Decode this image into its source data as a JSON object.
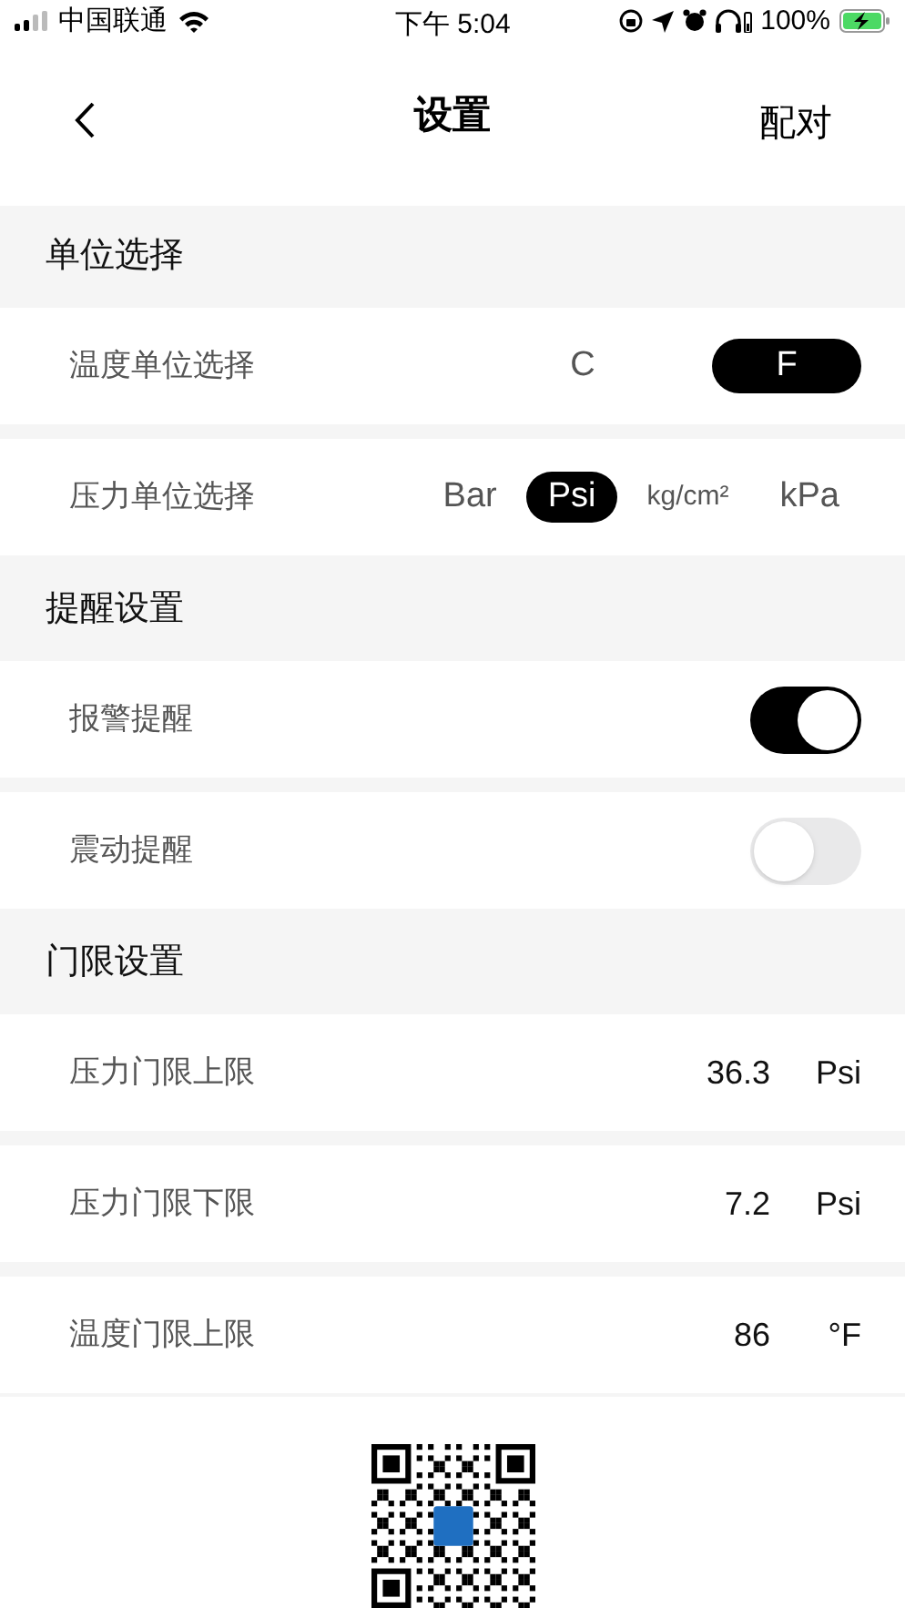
{
  "status_bar": {
    "carrier": "中国联通",
    "time": "下午 5:04",
    "battery": "100%"
  },
  "nav": {
    "title": "设置",
    "action": "配对"
  },
  "sections": [
    {
      "title": "单位选择",
      "rows": [
        {
          "kind": "segmented",
          "label": "温度单位选择",
          "options": [
            {
              "label": "C",
              "selected": false
            },
            {
              "label": "F",
              "selected": true
            }
          ]
        },
        {
          "kind": "segmented",
          "label": "压力单位选择",
          "options": [
            {
              "label": "Bar",
              "selected": false
            },
            {
              "label": "Psi",
              "selected": true
            },
            {
              "label": "kg/cm²",
              "selected": false
            },
            {
              "label": "kPa",
              "selected": false
            }
          ]
        }
      ]
    },
    {
      "title": "提醒设置",
      "rows": [
        {
          "kind": "toggle",
          "label": "报警提醒",
          "on": true
        },
        {
          "kind": "toggle",
          "label": "震动提醒",
          "on": false
        }
      ]
    },
    {
      "title": "门限设置",
      "rows": [
        {
          "kind": "value",
          "label": "压力门限上限",
          "value": "36.3",
          "unit": "Psi"
        },
        {
          "kind": "value",
          "label": "压力门限下限",
          "value": "7.2",
          "unit": "Psi"
        },
        {
          "kind": "value",
          "label": "温度门限上限",
          "value": "86",
          "unit": "°F"
        }
      ]
    }
  ],
  "footer": {
    "kind": "qr-code"
  }
}
